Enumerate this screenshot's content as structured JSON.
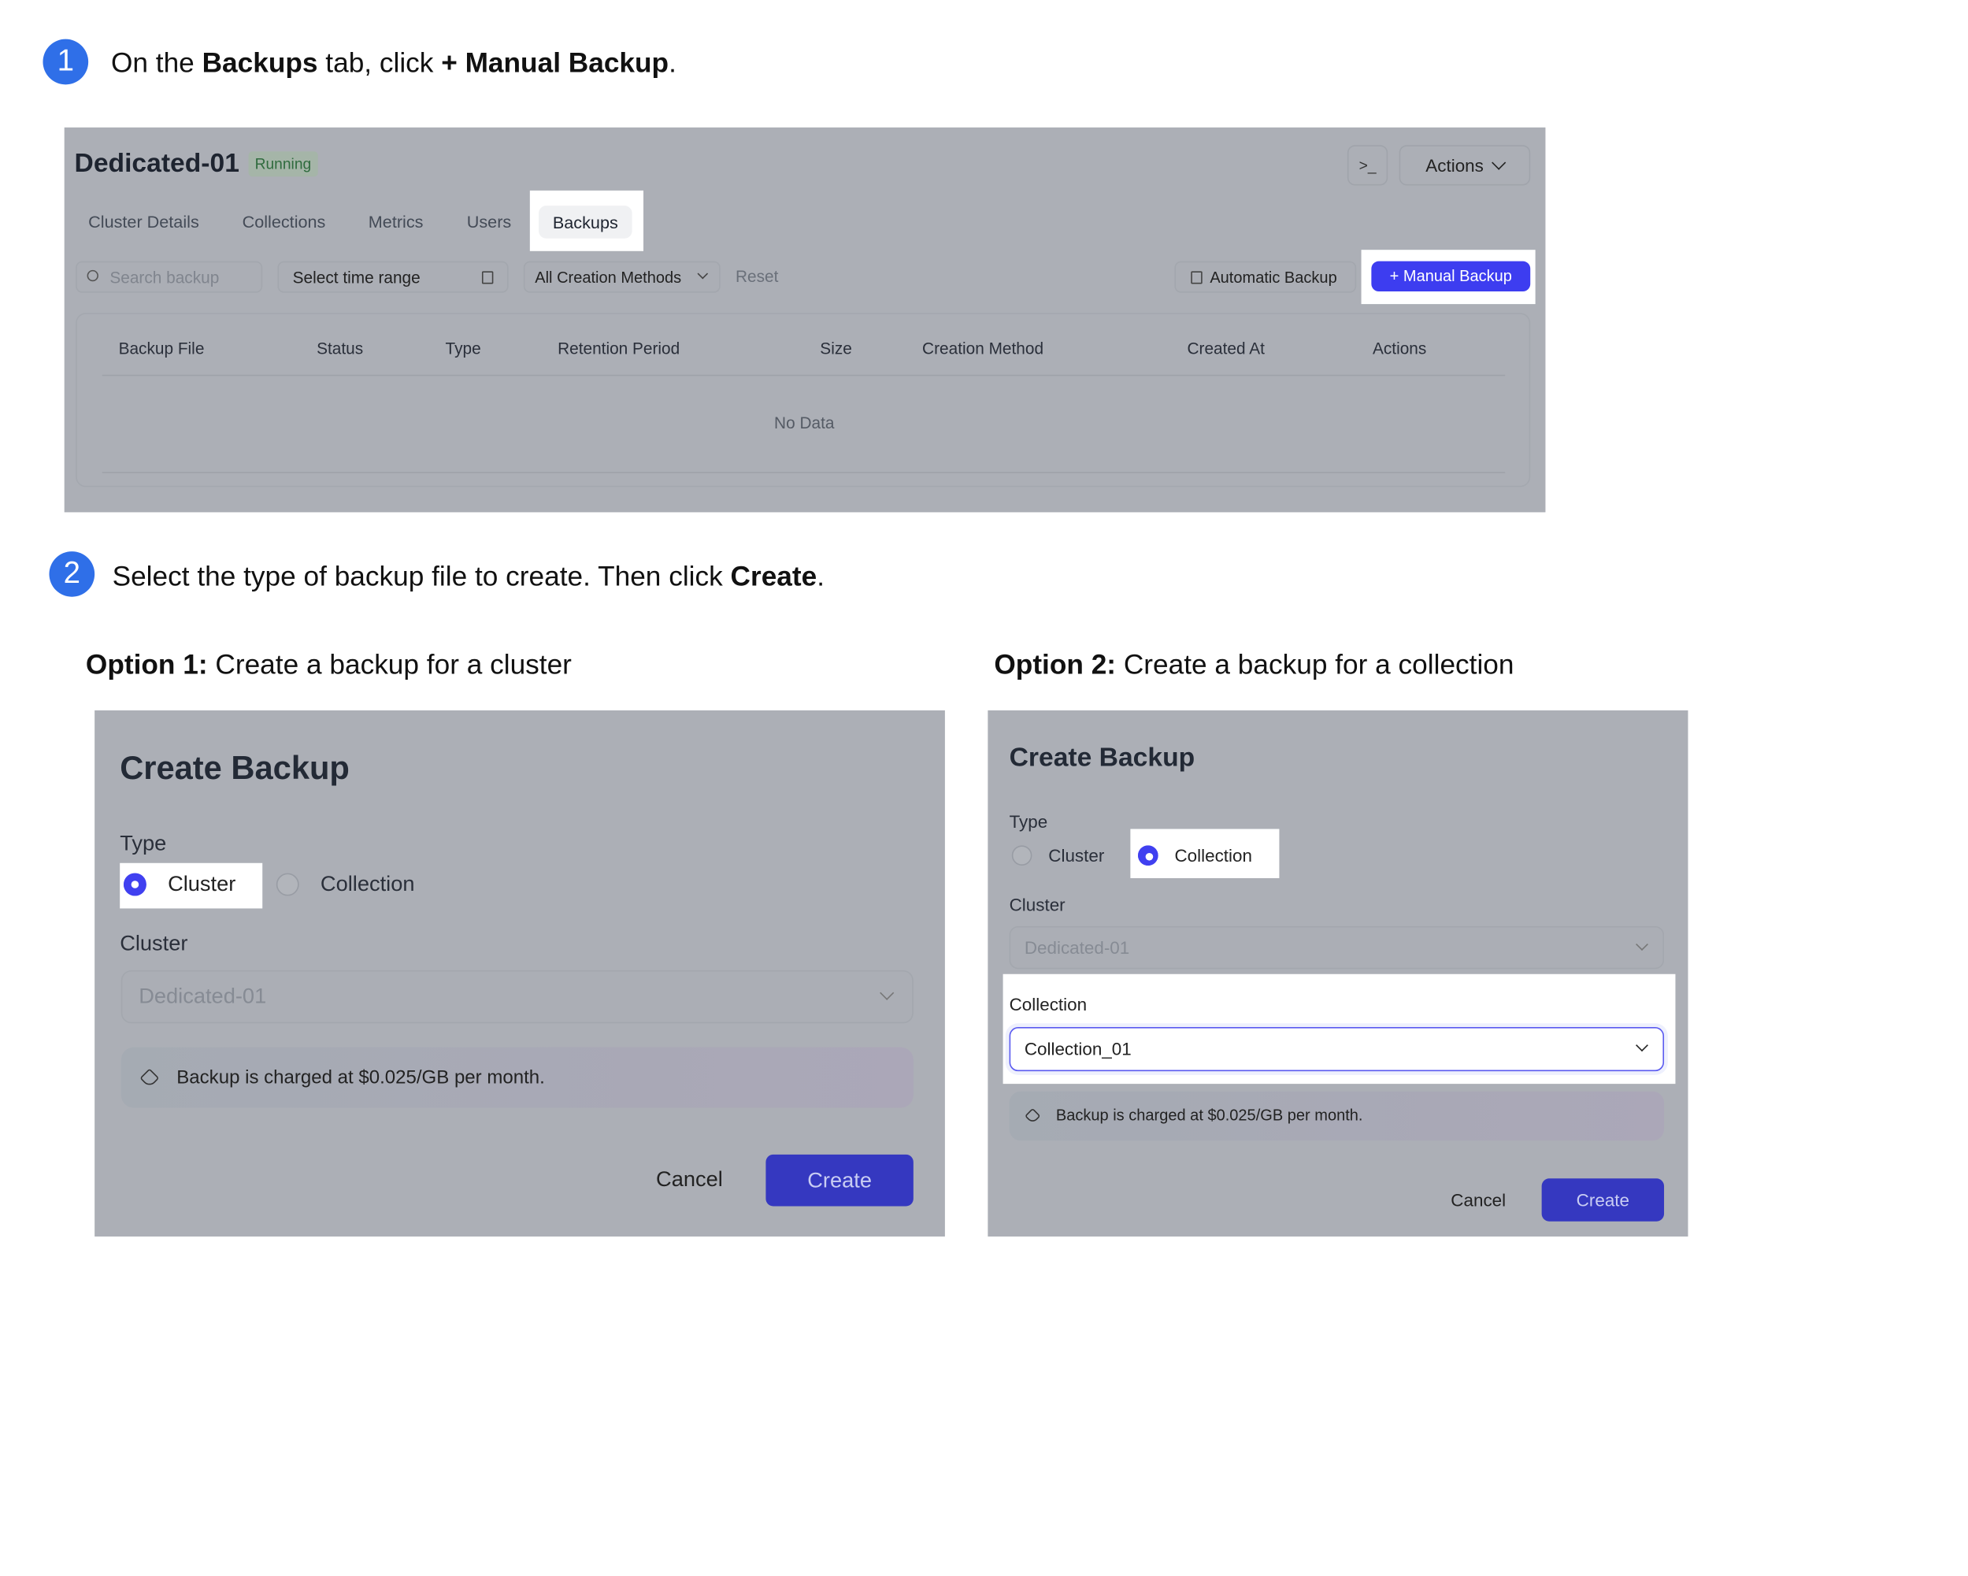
{
  "steps": [
    {
      "number": "1",
      "text_parts": [
        "On the ",
        "Backups",
        " tab, click ",
        "+ Manual Backup",
        "."
      ]
    },
    {
      "number": "2",
      "text_parts": [
        "Select the type of backup file to create. Then click ",
        "Create",
        "."
      ]
    }
  ],
  "options": [
    {
      "bold": "Option 1:",
      "text": " Create a backup for a cluster"
    },
    {
      "bold": "Option 2:",
      "text": " Create a backup for a collection"
    }
  ],
  "cluster_page": {
    "title": "Dedicated-01",
    "status": "Running",
    "terminal_icon": ">_",
    "actions_label": "Actions",
    "tabs": [
      "Cluster Details",
      "Collections",
      "Metrics",
      "Users",
      "Backups"
    ],
    "active_tab": "Backups",
    "search_placeholder": "Search backup",
    "time_range_placeholder": "Select time range",
    "creation_filter": "All Creation Methods",
    "reset_label": "Reset",
    "automatic_backup_label": "Automatic Backup",
    "manual_backup_label": "+ Manual Backup",
    "columns": [
      "Backup File",
      "Status",
      "Type",
      "Retention Period",
      "Size",
      "Creation Method",
      "Created At",
      "Actions"
    ],
    "empty_text": "No Data"
  },
  "dialog1": {
    "title": "Create Backup",
    "type_label": "Type",
    "type_options": [
      "Cluster",
      "Collection"
    ],
    "selected_type": "Cluster",
    "cluster_label": "Cluster",
    "cluster_value": "Dedicated-01",
    "notice": "Backup is charged at $0.025/GB per month.",
    "cancel": "Cancel",
    "create": "Create"
  },
  "dialog2": {
    "title": "Create Backup",
    "type_label": "Type",
    "type_options": [
      "Cluster",
      "Collection"
    ],
    "selected_type": "Collection",
    "cluster_label": "Cluster",
    "cluster_value": "Dedicated-01",
    "collection_label": "Collection",
    "collection_value": "Collection_01",
    "notice": "Backup is charged at $0.025/GB per month.",
    "cancel": "Cancel",
    "create": "Create"
  },
  "colors": {
    "step_badge": "#2f6fe8",
    "primary": "#4040f0",
    "overlay": "#acafb6",
    "create_button": "#3538c0"
  }
}
